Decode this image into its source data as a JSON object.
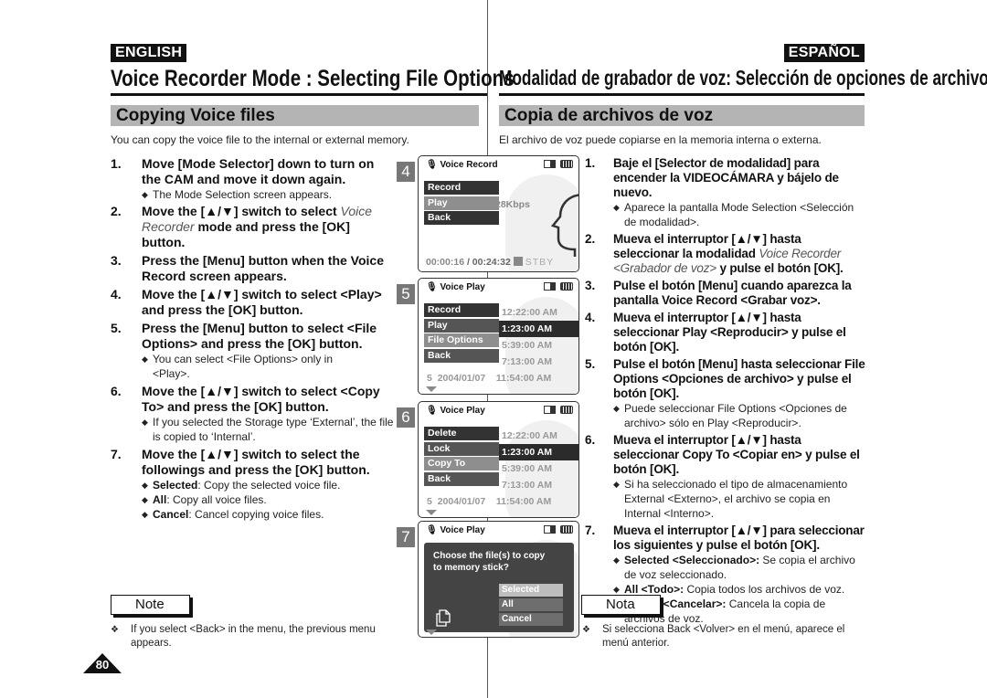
{
  "en": {
    "lang": "ENGLISH",
    "title": "Voice Recorder Mode : Selecting File Options",
    "section": "Copying Voice files",
    "intro": "You can copy the voice file to the internal or external memory.",
    "steps": [
      {
        "num": "1.",
        "text": "Move [Mode Selector] down to turn on the CAM and move it down again.",
        "bullets": [
          "The Mode Selection screen appears."
        ]
      },
      {
        "num": "2.",
        "text_pre": "Move the [▲/▼] switch to select ",
        "text_em": "Voice Recorder",
        "text_post": " mode and press the [OK] button.",
        "bullets": []
      },
      {
        "num": "3.",
        "text": "Press the [Menu] button when the Voice Record screen appears.",
        "bullets": []
      },
      {
        "num": "4.",
        "text": "Move the [▲/▼] switch to select <Play> and press the [OK] button.",
        "bullets": []
      },
      {
        "num": "5.",
        "text": "Press the [Menu] button to select <File Options> and press the [OK] button.",
        "bullets": [
          "You can select <File Options> only in <Play>."
        ]
      },
      {
        "num": "6.",
        "text": "Move the [▲/▼] switch to select <Copy To> and press the [OK] button.",
        "bullets": [
          "If you selected the Storage type ‘External’, the file is copied to ‘Internal’."
        ]
      },
      {
        "num": "7.",
        "text": "Move the [▲/▼] switch to select the followings and press the [OK] button.",
        "bullets_rich": [
          {
            "b": "Selected",
            "t": ": Copy the selected voice file."
          },
          {
            "b": "All",
            "t": ": Copy all voice files."
          },
          {
            "b": "Cancel",
            "t": ": Cancel copying voice files."
          }
        ]
      }
    ],
    "note_label": "Note",
    "note_text": "If you select <Back> in the menu, the previous menu appears."
  },
  "es": {
    "lang": "ESPAÑOL",
    "title": "Modalidad de grabador de voz: Selección de opciones de archivo",
    "section": "Copia de archivos de voz",
    "intro": "El archivo de voz puede copiarse en la memoria interna o externa.",
    "steps": [
      {
        "num": "1.",
        "text": "Baje el [Selector de modalidad] para encender la VIDEOCÁMARA y bájelo de nuevo.",
        "bullets": [
          "Aparece la pantalla Mode Selection <Selección de modalidad>."
        ]
      },
      {
        "num": "2.",
        "text_pre": "Mueva el interruptor [▲/▼] hasta seleccionar la modalidad ",
        "text_em": "Voice Recorder <Grabador de voz>",
        "text_post": " y pulse el botón [OK].",
        "bullets": []
      },
      {
        "num": "3.",
        "text": "Pulse el botón [Menu] cuando aparezca la pantalla Voice Record <Grabar voz>.",
        "bullets": []
      },
      {
        "num": "4.",
        "text": "Mueva el interruptor [▲/▼] hasta seleccionar Play <Reproducir> y pulse el botón [OK].",
        "bullets": []
      },
      {
        "num": "5.",
        "text": "Pulse el botón [Menu] hasta seleccionar File Options <Opciones de archivo> y pulse el botón [OK].",
        "bullets": [
          "Puede seleccionar File Options <Opciones de archivo> sólo en Play <Reproducir>."
        ]
      },
      {
        "num": "6.",
        "text": "Mueva el interruptor [▲/▼] hasta seleccionar Copy To <Copiar en> y pulse el botón [OK].",
        "bullets": [
          "Si ha seleccionado el tipo de almacenamiento External <Externo>, el archivo se copia en Internal <Interno>."
        ]
      },
      {
        "num": "7.",
        "text": "Mueva el interruptor [▲/▼] para seleccionar los siguientes y pulse el botón [OK].",
        "bullets_rich": [
          {
            "b": "Selected <Seleccionado>:",
            "t": " Se copia el archivo de voz seleccionado."
          },
          {
            "b": "All <Todo>:",
            "t": " Copia todos los archivos de voz."
          },
          {
            "b": "Cancel <Cancelar>:",
            "t": " Cancela la copia de archivos de voz."
          }
        ]
      }
    ],
    "note_label": "Nota",
    "note_text": "Si selecciona Back <Volver> en el menú, aparece el menú anterior."
  },
  "page_number": "80",
  "screens": {
    "s4": {
      "num": "4",
      "title": "Voice Record",
      "menu": [
        "Record",
        "Play",
        "Back"
      ],
      "bitrate": "28Kbps",
      "elapsed": "00:00:16",
      "separator": " / ",
      "remaining": "00:24:32",
      "status": "STBY"
    },
    "s5": {
      "num": "5",
      "title": "Voice Play",
      "menu": [
        "Record",
        "Play",
        "File Options",
        "Back"
      ],
      "times": [
        "12:22:00 AM",
        "1:23:00 AM",
        "5:39:00 AM",
        "7:13:00 AM"
      ],
      "last_row_index": "5",
      "last_row_date": "2004/01/07",
      "last_row_time": "11:54:00 AM"
    },
    "s6": {
      "num": "6",
      "title": "Voice Play",
      "menu": [
        "Delete",
        "Lock",
        "Copy To",
        "Back"
      ],
      "times": [
        "12:22:00 AM",
        "1:23:00 AM",
        "5:39:00 AM",
        "7:13:00 AM"
      ],
      "last_row_index": "5",
      "last_row_date": "2004/01/07",
      "last_row_time": "11:54:00 AM"
    },
    "s7": {
      "num": "7",
      "title": "Voice Play",
      "dialog_line1": "Choose the file(s) to copy",
      "dialog_line2": "to memory stick?",
      "options": [
        "Selected",
        "All",
        "Cancel"
      ]
    }
  },
  "icons": {
    "mic": "microphone-icon",
    "storage": "memory-storage-icon",
    "battery": "battery-icon",
    "copy": "copy-icon",
    "down": "down-arrow-icon"
  }
}
